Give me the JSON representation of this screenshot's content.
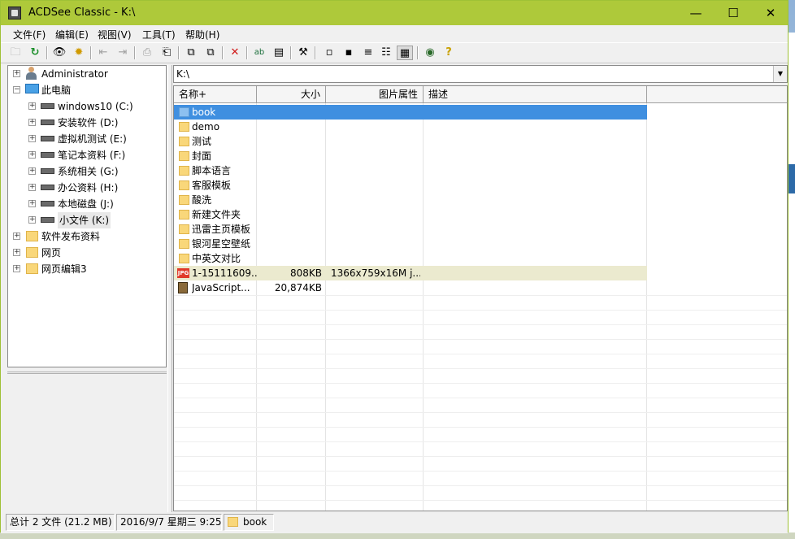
{
  "window": {
    "title": "ACDSee Classic - K:\\",
    "controls": {
      "minimize": "—",
      "maximize": "☐",
      "close": "✕"
    }
  },
  "menu": [
    {
      "label": "文件(F)"
    },
    {
      "label": "编辑(E)"
    },
    {
      "label": "视图(V)"
    },
    {
      "label": "工具(T)"
    },
    {
      "label": "帮助(H)"
    }
  ],
  "toolbar": {
    "icons": {
      "browse": "🗀",
      "refresh": "↻",
      "find": "👁",
      "slideshow": "✹",
      "prev": "⇤",
      "next": "⇥",
      "print": "⎙",
      "acquire": "⎗",
      "copy": "⧉",
      "paste": "⧉",
      "delete": "✕",
      "rename": "ab",
      "properties": "▤",
      "tools": "⚒",
      "large-icons": "▫",
      "small-icons": "▪",
      "list-view": "≡",
      "details-view": "☷",
      "thumbnails": "▦",
      "view": "◉",
      "help": "?"
    }
  },
  "tree": {
    "items": [
      {
        "label": "Administrator",
        "icon": "user-icon"
      },
      {
        "label": "此电脑",
        "icon": "computer-icon"
      },
      {
        "label": "windows10 (C:)",
        "icon": "drive-icon"
      },
      {
        "label": "安装软件 (D:)",
        "icon": "drive-icon"
      },
      {
        "label": "虚拟机测试 (E:)",
        "icon": "drive-icon"
      },
      {
        "label": "笔记本资料 (F:)",
        "icon": "drive-icon"
      },
      {
        "label": "系统相关 (G:)",
        "icon": "drive-icon"
      },
      {
        "label": "办公资料 (H:)",
        "icon": "drive-icon"
      },
      {
        "label": "本地磁盘 (J:)",
        "icon": "drive-icon"
      },
      {
        "label": "小文件 (K:)",
        "icon": "drive-icon"
      },
      {
        "label": "软件发布资料",
        "icon": "folder-icon"
      },
      {
        "label": "网页",
        "icon": "folder-icon"
      },
      {
        "label": "网页编辑3",
        "icon": "folder-icon"
      }
    ]
  },
  "address": {
    "value": "K:\\"
  },
  "list": {
    "columns": [
      "名称+",
      "大小",
      "图片属性",
      "描述"
    ],
    "rows": [
      {
        "name": "book",
        "size": "",
        "props": "",
        "type": "folder"
      },
      {
        "name": "demo",
        "size": "",
        "props": "",
        "type": "folder"
      },
      {
        "name": "测试",
        "size": "",
        "props": "",
        "type": "folder"
      },
      {
        "name": "封面",
        "size": "",
        "props": "",
        "type": "folder"
      },
      {
        "name": "脚本语言",
        "size": "",
        "props": "",
        "type": "folder"
      },
      {
        "name": "客服模板",
        "size": "",
        "props": "",
        "type": "folder"
      },
      {
        "name": "酸洗",
        "size": "",
        "props": "",
        "type": "folder"
      },
      {
        "name": "新建文件夹",
        "size": "",
        "props": "",
        "type": "folder"
      },
      {
        "name": "迅雷主页模板",
        "size": "",
        "props": "",
        "type": "folder"
      },
      {
        "name": "银河星空壁纸",
        "size": "",
        "props": "",
        "type": "folder"
      },
      {
        "name": "中英文对比",
        "size": "",
        "props": "",
        "type": "folder"
      },
      {
        "name": "1-15111609...",
        "size": "808KB",
        "props": "1366x759x16M j...",
        "type": "jpg"
      },
      {
        "name": "JavaScript...",
        "size": "20,874KB",
        "props": "",
        "type": "book"
      }
    ],
    "jpg_badge": "JPG"
  },
  "status": {
    "summary": "总计 2 文件 (21.2 MB)",
    "datetime": "2016/9/7 星期三 9:25",
    "current": "book"
  },
  "colors": {
    "titlebar": "#aec93a",
    "selection": "#3f8fe0",
    "highlight_row": "#ebeacf"
  }
}
